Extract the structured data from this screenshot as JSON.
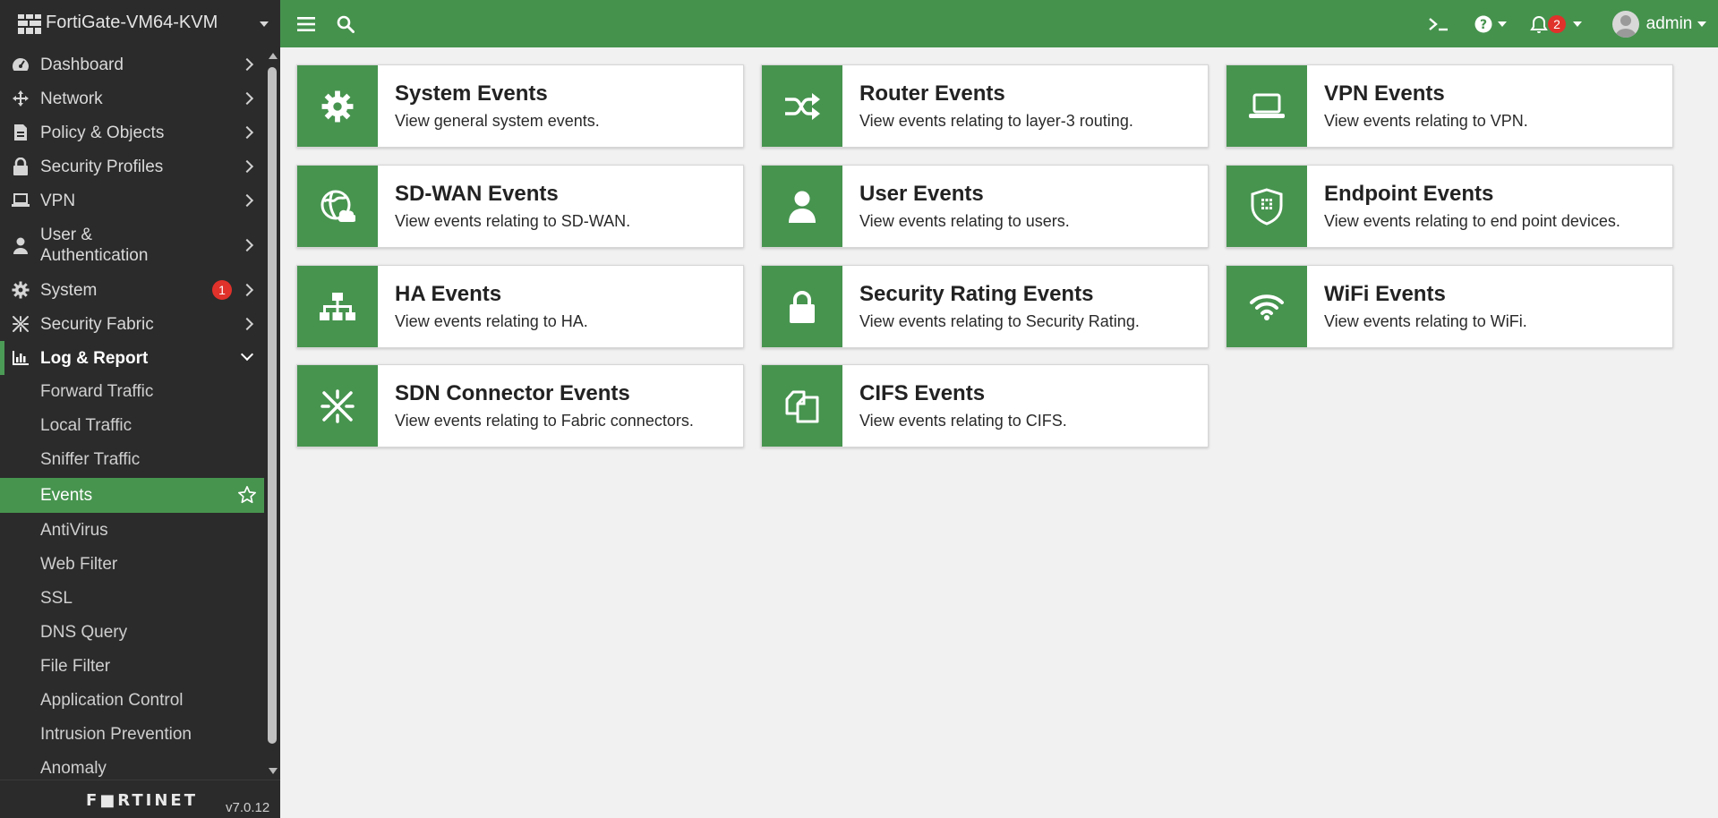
{
  "device": {
    "name": "FortiGate-VM64-KVM"
  },
  "nav": {
    "items": [
      {
        "label": "Dashboard",
        "icon": "dashboard-icon"
      },
      {
        "label": "Network",
        "icon": "network-icon"
      },
      {
        "label": "Policy & Objects",
        "icon": "policy-icon"
      },
      {
        "label": "Security Profiles",
        "icon": "lock-icon"
      },
      {
        "label": "VPN",
        "icon": "laptop-icon"
      },
      {
        "label": "User & Authentication",
        "label_line1": "User &",
        "label_line2": "Authentication",
        "icon": "user-icon"
      },
      {
        "label": "System",
        "icon": "gear-icon",
        "badge": "1"
      },
      {
        "label": "Security Fabric",
        "icon": "fabric-icon"
      },
      {
        "label": "Log & Report",
        "icon": "chart-icon",
        "expanded": true
      }
    ],
    "log_report_sub": [
      "Forward Traffic",
      "Local Traffic",
      "Sniffer Traffic",
      "Events",
      "AntiVirus",
      "Web Filter",
      "SSL",
      "DNS Query",
      "File Filter",
      "Application Control",
      "Intrusion Prevention",
      "Anomaly"
    ],
    "selected": "Events"
  },
  "footer": {
    "brand": "F■RTINET",
    "version": "v7.0.12"
  },
  "topbar": {
    "user": "admin",
    "notification_count": "2"
  },
  "cards": [
    {
      "title": "System Events",
      "desc": "View general system events.",
      "icon": "gear-icon"
    },
    {
      "title": "Router Events",
      "desc": "View events relating to layer-3 routing.",
      "icon": "shuffle-icon"
    },
    {
      "title": "VPN Events",
      "desc": "View events relating to VPN.",
      "icon": "laptop-icon"
    },
    {
      "title": "SD-WAN Events",
      "desc": "View events relating to SD-WAN.",
      "icon": "globe-cloud-icon"
    },
    {
      "title": "User Events",
      "desc": "View events relating to users.",
      "icon": "user-icon"
    },
    {
      "title": "Endpoint Events",
      "desc": "View events relating to end point devices.",
      "icon": "shield-icon"
    },
    {
      "title": "HA Events",
      "desc": "View events relating to HA.",
      "icon": "sitemap-icon"
    },
    {
      "title": "Security Rating Events",
      "desc": "View events relating to Security Rating.",
      "icon": "lock-icon"
    },
    {
      "title": "WiFi Events",
      "desc": "View events relating to WiFi.",
      "icon": "wifi-icon"
    },
    {
      "title": "SDN Connector Events",
      "desc": "View events relating to Fabric connectors.",
      "icon": "connector-icon"
    },
    {
      "title": "CIFS Events",
      "desc": "View events relating to CIFS.",
      "icon": "files-icon"
    }
  ],
  "colors": {
    "accent": "#45924d",
    "sidebar": "#2b2b2b",
    "badge": "#e0312b"
  }
}
